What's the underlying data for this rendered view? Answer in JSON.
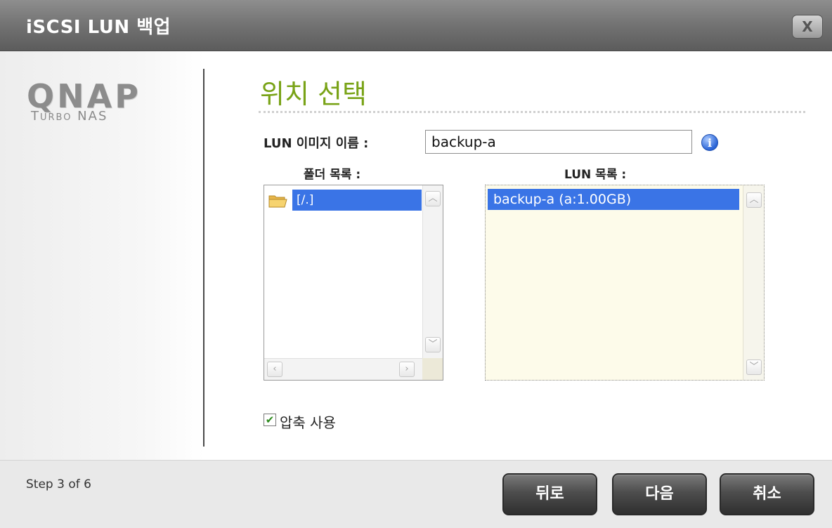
{
  "window": {
    "title": "iSCSI LUN 백업",
    "close_label": "X"
  },
  "brand": {
    "logo": "QNAP",
    "subtitle": "Turbo NAS"
  },
  "section": {
    "title": "위치 선택"
  },
  "lun_name": {
    "label": "LUN 이미지 이름 :",
    "value": "backup-a"
  },
  "folder_list": {
    "header": "폴더 목록 :",
    "items": [
      {
        "label": "[/.]",
        "selected": true
      }
    ]
  },
  "lun_list": {
    "header": "LUN 목록 :",
    "items": [
      {
        "label": "backup-a (a:1.00GB)",
        "selected": true
      }
    ]
  },
  "compression": {
    "label": "압축 사용",
    "checked": true
  },
  "footer": {
    "step_text": "Step 3 of 6",
    "back_label": "뒤로",
    "next_label": "다음",
    "cancel_label": "취소"
  },
  "colors": {
    "accent_green": "#79a317",
    "selection_blue": "#3a74e6"
  }
}
